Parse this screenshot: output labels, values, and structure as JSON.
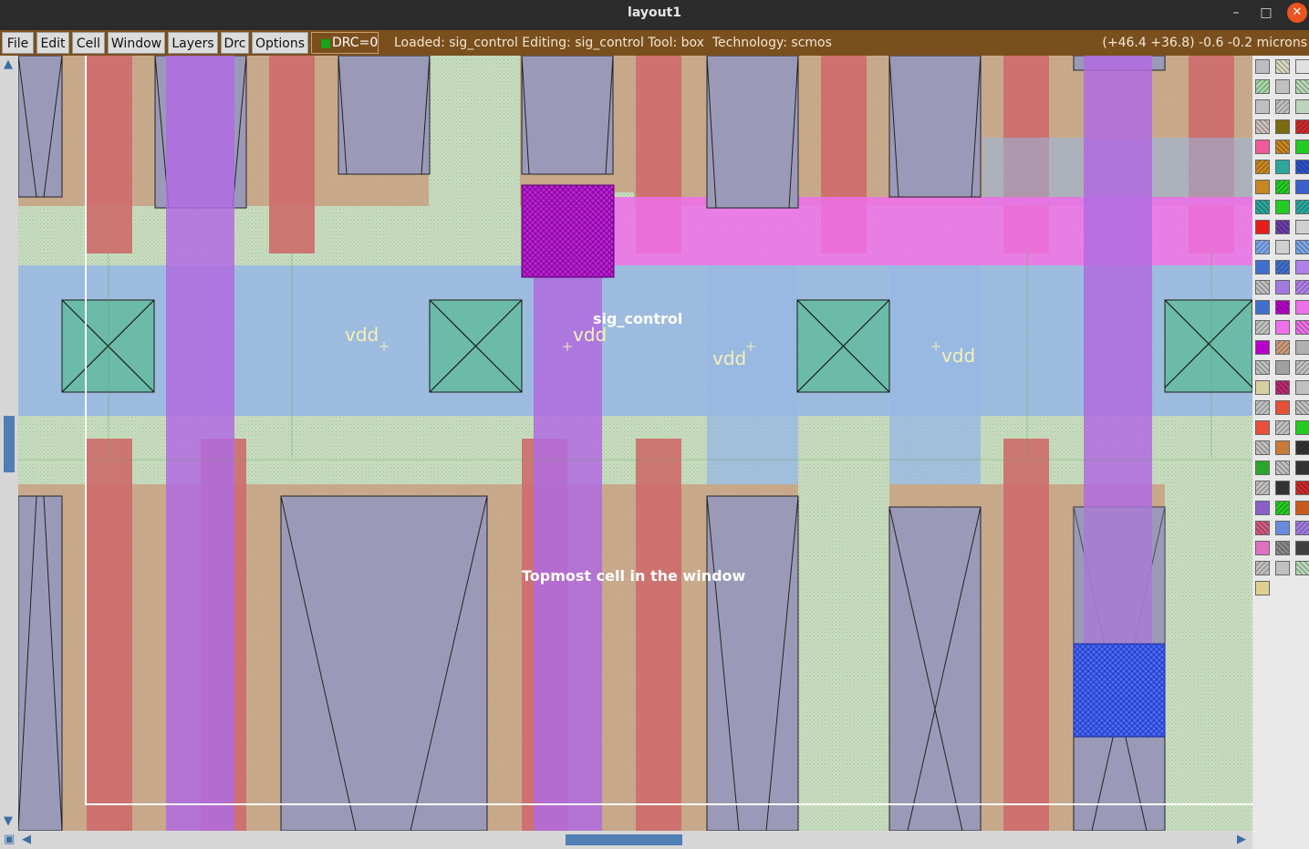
{
  "window": {
    "title": "layout1",
    "minimize_glyph": "–",
    "maximize_glyph": "□",
    "close_glyph": "✕"
  },
  "menu": {
    "items": [
      "File",
      "Edit",
      "Cell",
      "Window",
      "Layers",
      "Drc",
      "Options"
    ],
    "drc_label": "DRC=0"
  },
  "status": {
    "text": "Loaded: sig_control Editing: sig_control Tool: box  Technology: scmos",
    "coords": "(+46.4 +36.8) -0.6 -0.2 microns"
  },
  "layout": {
    "labels": {
      "vdd_1": "vdd",
      "vdd_2": "vdd",
      "vdd_3": "vdd",
      "vdd_4": "vdd",
      "cell_name": "sig_control",
      "topmost": "Topmost cell in the window"
    }
  },
  "colors": {
    "metal1": "#98b8e2",
    "metal2": "#b06be0",
    "poly": "#cd6b6b",
    "diffusion": "#c8a083",
    "well": "#c7dcbf",
    "contact": "#6bbba8",
    "transistor": "#9a9ab8",
    "via": "#c21fd9",
    "pin": "#ef6fea",
    "accent_bar": "#7a4f1e",
    "scroll_thumb": "#4f7fb3",
    "palette_colors": [
      "#bdbdbd",
      "#d8d8c0",
      "#e0e0e0",
      "#a6d6a6",
      "#c0c0c0",
      "#b8d8b8",
      "#c0c0c0",
      "#c0c0c0",
      "#bcd4bc",
      "#d0c0c0",
      "#7a6a10",
      "#cc2a2a",
      "#f05a9a",
      "#c8861e",
      "#22cc22",
      "#c8861e",
      "#2aa79c",
      "#2b54cc",
      "#c8861e",
      "#22cc22",
      "#3a5fcc",
      "#2aa79c",
      "#22cc22",
      "#2aa79c",
      "#e81c1c",
      "#6b3ea8",
      "#cfcfcf",
      "#7ba6e8",
      "#d0d0d0",
      "#7ba6e8",
      "#3f6fcc",
      "#3f6fcc",
      "#b07fe8",
      "#c0c0c0",
      "#a07ae0",
      "#b07fe8",
      "#3f6fcc",
      "#b800c8",
      "#ef6fea",
      "#c0c0c0",
      "#ef6fea",
      "#ef6fea",
      "#b800c8",
      "#c89a7a",
      "#b0b0b0",
      "#c0c0c0",
      "#a0a0a0",
      "#c0c0c0",
      "#d8d0a0",
      "#b82a70",
      "#c0c0c0",
      "#c0c0c0",
      "#e8503a",
      "#c0c0c0",
      "#e8503a",
      "#c0c0c0",
      "#22cc22",
      "#c0c0c0",
      "#c87a3a",
      "#333333",
      "#2aa72a",
      "#c0c0c0",
      "#333333",
      "#c0c0c0",
      "#333333",
      "#cc2a2a",
      "#8a5fc8",
      "#22cc22",
      "#c85a1e",
      "#d05a80",
      "#6b8be0",
      "#a07ae0",
      "#e070c0",
      "#888888",
      "#404040",
      "#c0c0c0",
      "#c0c0c0",
      "#b8d8b8",
      "#e0d090"
    ]
  }
}
